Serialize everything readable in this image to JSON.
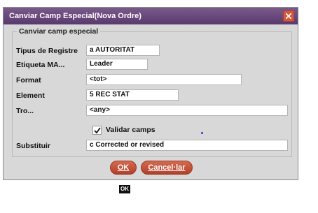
{
  "dialog": {
    "title": "Canviar Camp Especial(Nova Ordre)",
    "close_icon": "close-x-icon",
    "group_title": "Canviar camp especial",
    "fields": {
      "tipus_label": "Tipus de Registre",
      "tipus_value": "a  AUTORITAT",
      "etiqueta_label": "Etiqueta MA...",
      "etiqueta_value": "Leader",
      "format_label": "Format",
      "format_value": "<tot>",
      "element_label": "Element",
      "element_value": "5  REC STAT",
      "tro_label": "Tro...",
      "tro_value": "<any>",
      "validar_label": "Validar camps",
      "validar_checked": true,
      "substituir_label": "Substituir",
      "substituir_value": "c Corrected or revised"
    },
    "buttons": {
      "ok": "OK",
      "cancel": "Cancel·lar"
    }
  },
  "tooltip": {
    "text": "OK"
  },
  "colors": {
    "title_bar": "#5a3a6e",
    "button": "#b0402a",
    "dialog_bg": "#d8d8d8"
  }
}
